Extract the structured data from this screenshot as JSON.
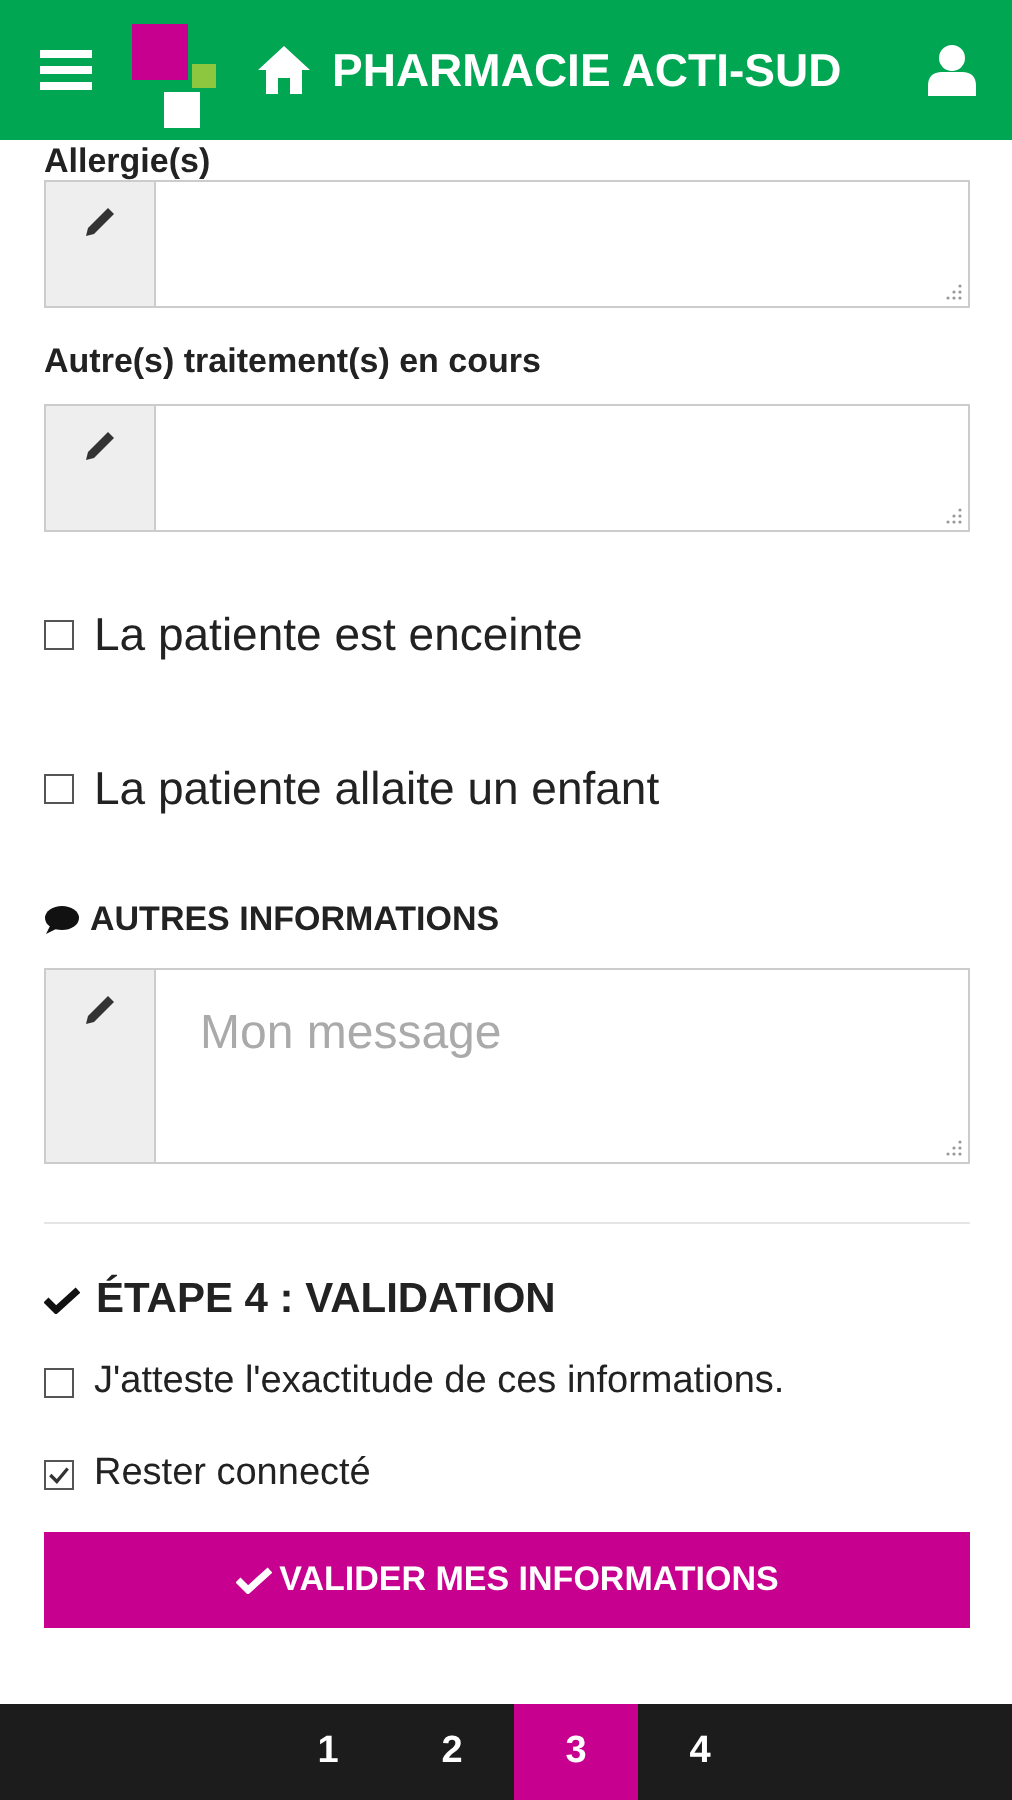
{
  "header": {
    "title": "PHARMACIE ACTI-SUD"
  },
  "fields": [
    {
      "label": "Allergie(s)"
    },
    {
      "label": "Autre(s) traitement(s) en cours"
    }
  ],
  "checkboxes": [
    {
      "label": "La patiente est enceinte",
      "checked": false
    },
    {
      "label": "La patiente allaite un enfant",
      "checked": false
    }
  ],
  "other_info": {
    "heading": "AUTRES INFORMATIONS",
    "placeholder": "Mon message"
  },
  "validation": {
    "heading": "ÉTAPE 4 : VALIDATION",
    "checkboxes": [
      {
        "label": "J'atteste l'exactitude de ces informations.",
        "checked": false
      },
      {
        "label": "Rester connecté",
        "checked": true
      }
    ],
    "button": "VALIDER MES INFORMATIONS"
  },
  "steps": [
    {
      "label": "1",
      "selected": false
    },
    {
      "label": "2",
      "selected": false
    },
    {
      "label": "3",
      "selected": true
    },
    {
      "label": "4",
      "selected": false
    }
  ]
}
